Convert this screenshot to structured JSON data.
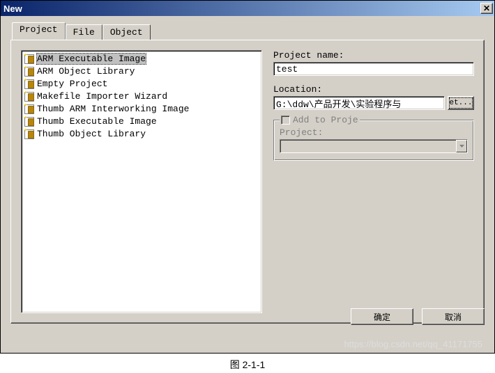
{
  "window": {
    "title": "New"
  },
  "tabs": [
    {
      "label": "Project",
      "active": true
    },
    {
      "label": "File",
      "active": false
    },
    {
      "label": "Object",
      "active": false
    }
  ],
  "project_types": [
    {
      "label": "ARM Executable Image",
      "selected": true
    },
    {
      "label": "ARM Object Library",
      "selected": false
    },
    {
      "label": "Empty Project",
      "selected": false
    },
    {
      "label": "Makefile Importer Wizard",
      "selected": false
    },
    {
      "label": "Thumb ARM Interworking Image",
      "selected": false
    },
    {
      "label": "Thumb Executable Image",
      "selected": false
    },
    {
      "label": "Thumb Object Library",
      "selected": false
    }
  ],
  "fields": {
    "project_name_label": "Project name:",
    "project_name_value": "test",
    "location_label": "Location:",
    "location_value": "G:\\ddw\\产品开发\\实验程序与",
    "browse_label": "et..."
  },
  "groupbox": {
    "checkbox_label": "Add to Proje",
    "project_label": "Project:"
  },
  "buttons": {
    "ok": "确定",
    "cancel": "取消"
  },
  "caption": "图 2-1-1",
  "watermark": "https://blog.csdn.net/qq_41171755"
}
